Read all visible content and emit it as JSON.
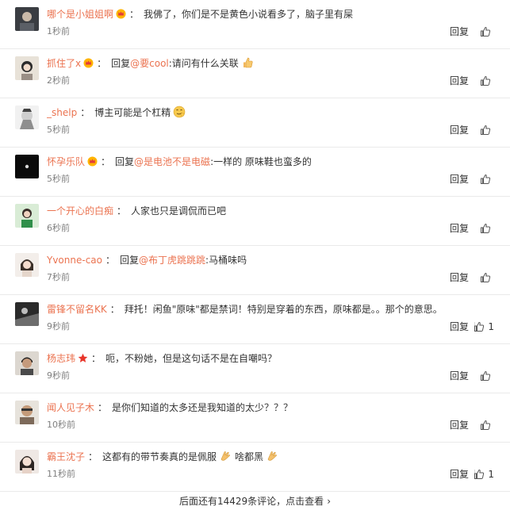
{
  "comments": [
    {
      "user": "哪个是小姐姐啊",
      "badge": "crown",
      "text": "我佛了，你们是不是黄色小说看多了，脑子里有屎",
      "time": "1秒前",
      "reply": "回复",
      "likes": ""
    },
    {
      "user": "抓住了x",
      "badge": "crown",
      "reply_prefix": "回复",
      "mention": "@要cool",
      "after_mention": ":请问有什么关联",
      "emoji": "thumb",
      "time": "2秒前",
      "reply": "回复",
      "likes": ""
    },
    {
      "user": "_shelp",
      "text": "博主可能是个杠精",
      "emoji": "face",
      "time": "5秒前",
      "reply": "回复",
      "likes": ""
    },
    {
      "user": "怀孕乐队",
      "badge": "crown",
      "reply_prefix": "回复",
      "mention": "@是电池不是电磁",
      "after_mention": ":一样的 原味鞋也蛮多的",
      "time": "5秒前",
      "reply": "回复",
      "likes": ""
    },
    {
      "user": "一个开心的白痴",
      "text": "人家也只是调侃而已吧",
      "time": "6秒前",
      "reply": "回复",
      "likes": ""
    },
    {
      "user": "Yvonne-cao",
      "reply_prefix": "回复",
      "mention": "@布丁虎跳跳跳",
      "after_mention": ":马桶味吗",
      "time": "7秒前",
      "reply": "回复",
      "likes": ""
    },
    {
      "user": "雷锋不留名KK",
      "text": "拜托！闲鱼\"原味\"都是禁词！特别是穿着的东西，原味都是。。那个的意思。",
      "time": "9秒前",
      "reply": "回复",
      "likes": "1"
    },
    {
      "user": "杨志玮",
      "badge": "star",
      "text": "呃，不粉她，但是这句话不是在自嘲吗？",
      "time": "9秒前",
      "reply": "回复",
      "likes": ""
    },
    {
      "user": "闻人见子木",
      "text": "是你们知道的太多还是我知道的太少？？？",
      "time": "10秒前",
      "reply": "回复",
      "likes": ""
    },
    {
      "user": "霸王沈子",
      "text": "这都有的带节奏真的是佩服",
      "emoji": "clap",
      "text2": "啥都黑",
      "emoji2": "clap",
      "time": "11秒前",
      "reply": "回复",
      "likes": "1"
    }
  ],
  "more_text": "后面还有14429条评论，点击查看",
  "more_chevron": "›",
  "colors": {
    "link": "#eb7350",
    "text": "#333333",
    "time": "#808080"
  }
}
